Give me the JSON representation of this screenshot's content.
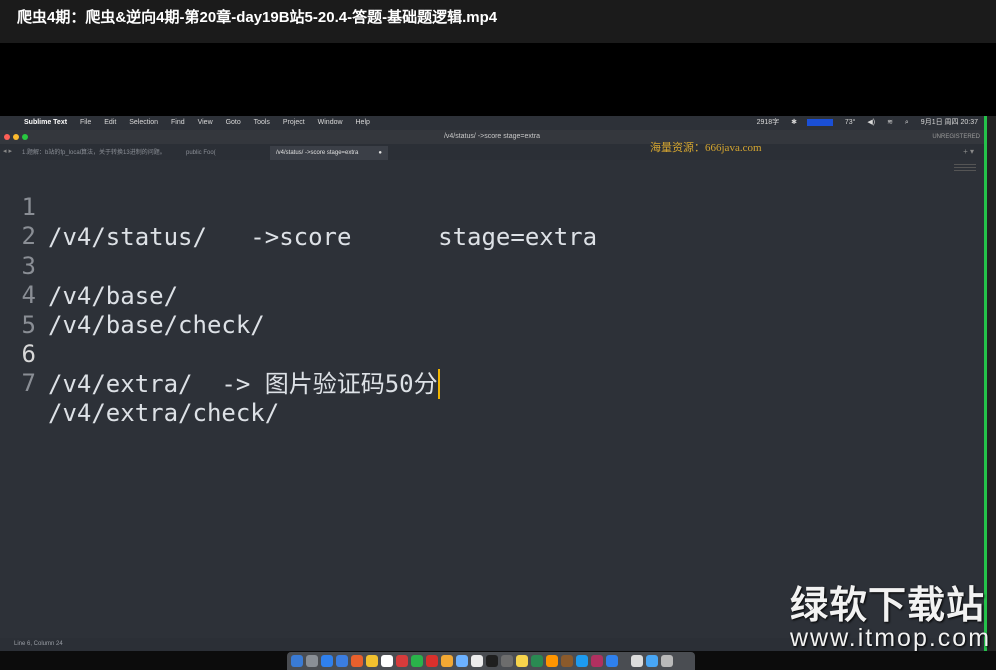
{
  "video_title": "爬虫4期：爬虫&逆向4期-第20章-day19B站5-20.4-答题-基础题逻辑.mp4",
  "menubar": {
    "app_name": "Sublime Text",
    "items": [
      "File",
      "Edit",
      "Selection",
      "Find",
      "View",
      "Goto",
      "Tools",
      "Project",
      "Window",
      "Help"
    ],
    "status": {
      "wordcount": "2918字",
      "weather": "73°",
      "datetime": "9月1日 周四 20:37"
    }
  },
  "window": {
    "title": "/v4/status/    ->score      stage=extra",
    "license": "UNREGISTERED",
    "colors": {
      "close": "#ff5f57",
      "minimize": "#febc2e",
      "zoom": "#28c840"
    }
  },
  "tabs": [
    {
      "label": "1.题解：b站的fp_local算法，关于转换13进制的问题。",
      "active": false
    },
    {
      "label": "public Foo(",
      "active": false
    },
    {
      "label": "/v4/status/   ->score      stage=extra",
      "active": true
    }
  ],
  "overlay_watermark": "海量资源：666java.com",
  "editor": {
    "lines": [
      {
        "num": "1",
        "text": "/v4/status/   ->score      stage=extra"
      },
      {
        "num": "2",
        "text": ""
      },
      {
        "num": "3",
        "text": "/v4/base/"
      },
      {
        "num": "4",
        "text": "/v4/base/check/"
      },
      {
        "num": "5",
        "text": ""
      },
      {
        "num": "6",
        "text": "/v4/extra/  -> 图片验证码50分",
        "current": true
      },
      {
        "num": "7",
        "text": "/v4/extra/check/"
      }
    ],
    "cursor_color": "#f0b400",
    "background": "#2d3138"
  },
  "statusbar": {
    "position": "Line 6, Column 24"
  },
  "site_watermark": {
    "name": "绿软下载站",
    "url": "www.itmop.com"
  },
  "icons": [
    "apple-icon",
    "close-button-icon",
    "minimize-button-icon",
    "zoom-button-icon",
    "wifi-icon",
    "search-icon",
    "volume-icon",
    "bluetooth-icon",
    "battery-icon",
    "dock-app-icons"
  ]
}
